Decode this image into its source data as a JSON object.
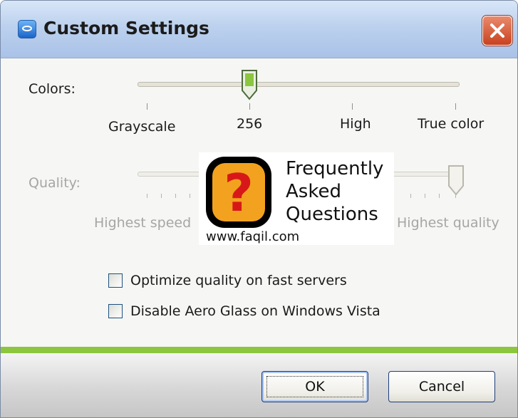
{
  "window": {
    "title": "Custom Settings",
    "icon": "teamviewer-icon"
  },
  "colors": {
    "label": "Colors:",
    "ticks": [
      "Grayscale",
      "256",
      "High",
      "True color"
    ],
    "selected_index": 1
  },
  "quality": {
    "label": "Quality:",
    "left_label": "Highest speed",
    "right_label": "Highest quality",
    "enabled": false
  },
  "options": [
    {
      "label": "Optimize quality on fast servers",
      "checked": false
    },
    {
      "label": "Disable Aero Glass on Windows Vista",
      "checked": false
    }
  ],
  "watermark": {
    "lines": [
      "Frequently",
      "Asked",
      "Questions"
    ],
    "url": "www.faqil.com"
  },
  "buttons": {
    "ok": "OK",
    "cancel": "Cancel"
  },
  "accent": {
    "green": "#8cc63f",
    "title_blue": "#bcd1ee"
  }
}
